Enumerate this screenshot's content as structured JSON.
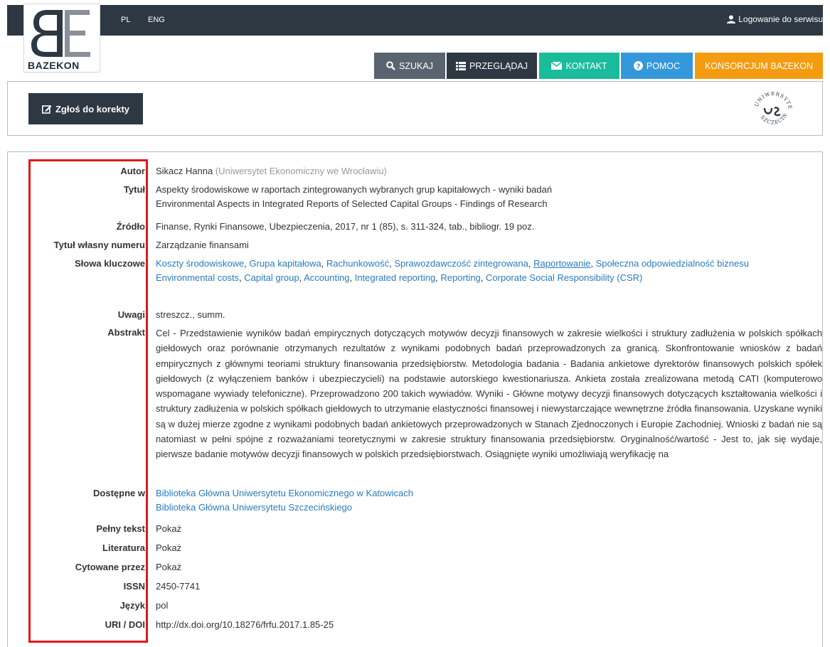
{
  "nav": {
    "lang_pl": "PL",
    "lang_eng": "ENG",
    "login": "Logowanie do serwisu",
    "logo_text": "BAZEKON",
    "items": [
      {
        "label": "SZUKAJ",
        "icon": "search-icon"
      },
      {
        "label": "PRZEGLĄDAJ",
        "icon": "list-icon"
      },
      {
        "label": "KONTAKT",
        "icon": "envelope-icon"
      },
      {
        "label": "POMOC",
        "icon": "question-icon"
      },
      {
        "label": "KONSORCJUM BAZEKON",
        "icon": ""
      }
    ],
    "colors": {
      "dark": "#2d3843",
      "szukaj": "#5a6470",
      "kontakt": "#1abc9c",
      "pomoc": "#3498db",
      "konsorcjum": "#f39c12"
    }
  },
  "actions": {
    "report_correction": "Zgłoś do korekty"
  },
  "record": {
    "author_label": "Autor",
    "author": "Sikacz Hanna",
    "author_affiliation": "(Uniwersytet Ekonomiczny we Wrocławiu)",
    "title_label": "Tytuł",
    "title_pl": "Aspekty środowiskowe w raportach zintegrowanych wybranych grup kapitałowych - wyniki badań",
    "title_en": "Environmental Aspects in Integrated Reports of Selected Capital Groups - Findings of Research",
    "source_label": "Źródło",
    "source": "Finanse, Rynki Finansowe, Ubezpieczenia, 2017, nr 1 (85), s. 311-324, tab., bibliogr. 19 poz.",
    "issue_title_label": "Tytuł własny numeru",
    "issue_title": "Zarządzanie finansami",
    "keywords_label": "Słowa kluczowe",
    "keywords_pl": [
      "Koszty środowiskowe",
      "Grupa kapitałowa",
      "Rachunkowość",
      "Sprawozdawczość zintegrowana",
      "Raportowanie",
      "Społeczna odpowiedzialność biznesu"
    ],
    "keywords_en": [
      "Environmental costs",
      "Capital group",
      "Accounting",
      "Integrated reporting",
      "Reporting",
      "Corporate Social Responsibility (CSR)"
    ],
    "notes_label": "Uwagi",
    "notes": "streszcz., summ.",
    "abstract_label": "Abstrakt",
    "abstract": "Cel - Przedstawienie wyników badań empirycznych dotyczących motywów decyzji finansowych w zakresie wielkości i struktury zadłużenia w polskich spółkach giełdowych oraz porównanie otrzymanych rezultatów z wynikami podobnych badań przeprowadzonych za granicą. Skonfrontowanie wniosków z badań empirycznych z głównymi teoriami struktury finansowania przedsiębiorstw. Metodologia badania - Badania ankietowe dyrektorów finansowych polskich spółek giełdowych (z wyłączeniem banków i ubezpieczycieli) na podstawie autorskiego kwestionariusza. Ankieta została zrealizowana metodą CATI (komputerowo wspomagane wywiady telefoniczne). Przeprowadzono 200 takich wywiadów. Wyniki - Główne motywy decyzji finansowych dotyczących kształtowania wielkości i struktury zadłużenia w polskich spółkach giełdowych to utrzymanie elastyczności finansowej i niewystarczające wewnętrzne źródła finansowania. Uzyskane wyniki są w dużej mierze zgodne z wynikami podobnych badań ankietowych przeprowadzonych w Stanach Zjednoczonych i Europie Zachodniej. Wnioski z badań nie są natomiast w pełni spójne z rozważaniami teoretycznymi w zakresie struktury finansowania przedsiębiorstw. Oryginalność/wartość - Jest to, jak się wydaje, pierwsze badanie motywów decyzji finansowych w polskich przedsiębiorstwach. Osiągnięte wyniki umożliwiają weryfikację na",
    "available_label": "Dostępne w",
    "available": [
      "Biblioteka Główna Uniwersytetu Ekonomicznego w Katowicach",
      "Biblioteka Główna Uniwersytetu Szczecińskiego"
    ],
    "fulltext_label": "Pełny tekst",
    "fulltext": "Pokaż",
    "literature_label": "Literatura",
    "literature": "Pokaż",
    "cited_label": "Cytowane przez",
    "cited": "Pokaż",
    "issn_label": "ISSN",
    "issn": "2450-7741",
    "language_label": "Język",
    "language": "pol",
    "doi_label": "URI / DOI",
    "doi": "http://dx.doi.org/10.18276/frfu.2017.1.85-25"
  }
}
